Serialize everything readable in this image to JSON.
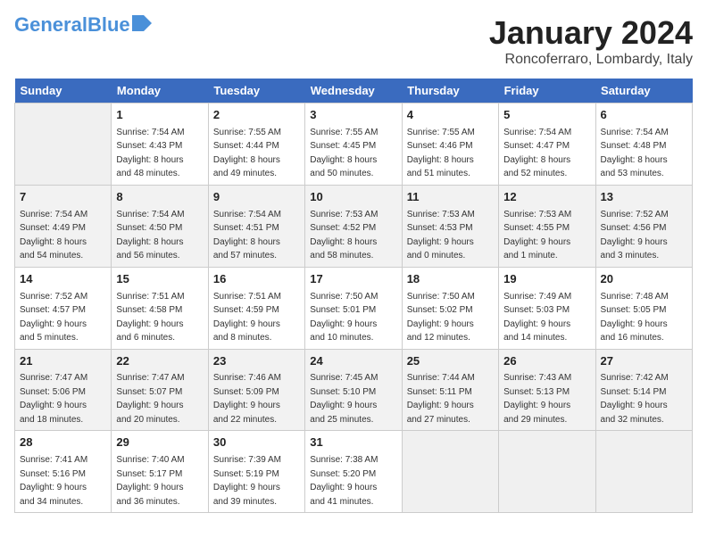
{
  "header": {
    "logo_line1": "General",
    "logo_line2": "Blue",
    "month": "January 2024",
    "location": "Roncoferraro, Lombardy, Italy"
  },
  "weekdays": [
    "Sunday",
    "Monday",
    "Tuesday",
    "Wednesday",
    "Thursday",
    "Friday",
    "Saturday"
  ],
  "weeks": [
    [
      {
        "day": "",
        "info": ""
      },
      {
        "day": "1",
        "info": "Sunrise: 7:54 AM\nSunset: 4:43 PM\nDaylight: 8 hours\nand 48 minutes."
      },
      {
        "day": "2",
        "info": "Sunrise: 7:55 AM\nSunset: 4:44 PM\nDaylight: 8 hours\nand 49 minutes."
      },
      {
        "day": "3",
        "info": "Sunrise: 7:55 AM\nSunset: 4:45 PM\nDaylight: 8 hours\nand 50 minutes."
      },
      {
        "day": "4",
        "info": "Sunrise: 7:55 AM\nSunset: 4:46 PM\nDaylight: 8 hours\nand 51 minutes."
      },
      {
        "day": "5",
        "info": "Sunrise: 7:54 AM\nSunset: 4:47 PM\nDaylight: 8 hours\nand 52 minutes."
      },
      {
        "day": "6",
        "info": "Sunrise: 7:54 AM\nSunset: 4:48 PM\nDaylight: 8 hours\nand 53 minutes."
      }
    ],
    [
      {
        "day": "7",
        "info": "Sunrise: 7:54 AM\nSunset: 4:49 PM\nDaylight: 8 hours\nand 54 minutes."
      },
      {
        "day": "8",
        "info": "Sunrise: 7:54 AM\nSunset: 4:50 PM\nDaylight: 8 hours\nand 56 minutes."
      },
      {
        "day": "9",
        "info": "Sunrise: 7:54 AM\nSunset: 4:51 PM\nDaylight: 8 hours\nand 57 minutes."
      },
      {
        "day": "10",
        "info": "Sunrise: 7:53 AM\nSunset: 4:52 PM\nDaylight: 8 hours\nand 58 minutes."
      },
      {
        "day": "11",
        "info": "Sunrise: 7:53 AM\nSunset: 4:53 PM\nDaylight: 9 hours\nand 0 minutes."
      },
      {
        "day": "12",
        "info": "Sunrise: 7:53 AM\nSunset: 4:55 PM\nDaylight: 9 hours\nand 1 minute."
      },
      {
        "day": "13",
        "info": "Sunrise: 7:52 AM\nSunset: 4:56 PM\nDaylight: 9 hours\nand 3 minutes."
      }
    ],
    [
      {
        "day": "14",
        "info": "Sunrise: 7:52 AM\nSunset: 4:57 PM\nDaylight: 9 hours\nand 5 minutes."
      },
      {
        "day": "15",
        "info": "Sunrise: 7:51 AM\nSunset: 4:58 PM\nDaylight: 9 hours\nand 6 minutes."
      },
      {
        "day": "16",
        "info": "Sunrise: 7:51 AM\nSunset: 4:59 PM\nDaylight: 9 hours\nand 8 minutes."
      },
      {
        "day": "17",
        "info": "Sunrise: 7:50 AM\nSunset: 5:01 PM\nDaylight: 9 hours\nand 10 minutes."
      },
      {
        "day": "18",
        "info": "Sunrise: 7:50 AM\nSunset: 5:02 PM\nDaylight: 9 hours\nand 12 minutes."
      },
      {
        "day": "19",
        "info": "Sunrise: 7:49 AM\nSunset: 5:03 PM\nDaylight: 9 hours\nand 14 minutes."
      },
      {
        "day": "20",
        "info": "Sunrise: 7:48 AM\nSunset: 5:05 PM\nDaylight: 9 hours\nand 16 minutes."
      }
    ],
    [
      {
        "day": "21",
        "info": "Sunrise: 7:47 AM\nSunset: 5:06 PM\nDaylight: 9 hours\nand 18 minutes."
      },
      {
        "day": "22",
        "info": "Sunrise: 7:47 AM\nSunset: 5:07 PM\nDaylight: 9 hours\nand 20 minutes."
      },
      {
        "day": "23",
        "info": "Sunrise: 7:46 AM\nSunset: 5:09 PM\nDaylight: 9 hours\nand 22 minutes."
      },
      {
        "day": "24",
        "info": "Sunrise: 7:45 AM\nSunset: 5:10 PM\nDaylight: 9 hours\nand 25 minutes."
      },
      {
        "day": "25",
        "info": "Sunrise: 7:44 AM\nSunset: 5:11 PM\nDaylight: 9 hours\nand 27 minutes."
      },
      {
        "day": "26",
        "info": "Sunrise: 7:43 AM\nSunset: 5:13 PM\nDaylight: 9 hours\nand 29 minutes."
      },
      {
        "day": "27",
        "info": "Sunrise: 7:42 AM\nSunset: 5:14 PM\nDaylight: 9 hours\nand 32 minutes."
      }
    ],
    [
      {
        "day": "28",
        "info": "Sunrise: 7:41 AM\nSunset: 5:16 PM\nDaylight: 9 hours\nand 34 minutes."
      },
      {
        "day": "29",
        "info": "Sunrise: 7:40 AM\nSunset: 5:17 PM\nDaylight: 9 hours\nand 36 minutes."
      },
      {
        "day": "30",
        "info": "Sunrise: 7:39 AM\nSunset: 5:19 PM\nDaylight: 9 hours\nand 39 minutes."
      },
      {
        "day": "31",
        "info": "Sunrise: 7:38 AM\nSunset: 5:20 PM\nDaylight: 9 hours\nand 41 minutes."
      },
      {
        "day": "",
        "info": ""
      },
      {
        "day": "",
        "info": ""
      },
      {
        "day": "",
        "info": ""
      }
    ]
  ]
}
